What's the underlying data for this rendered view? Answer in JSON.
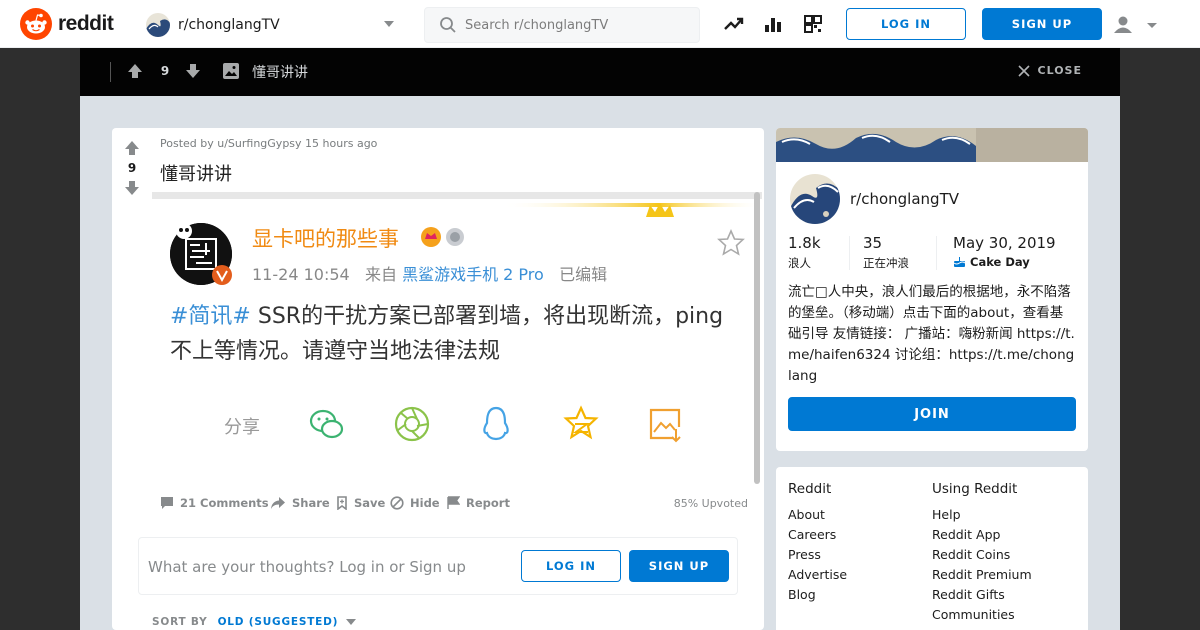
{
  "header": {
    "logo_text": "reddit",
    "community": "r/chonglangTV",
    "search_placeholder": "Search r/chonglangTV",
    "icons": [
      "trending-icon",
      "stats-icon",
      "coins-icon"
    ],
    "login_label": "LOG IN",
    "signup_label": "SIGN UP"
  },
  "overlay": {
    "score": "9",
    "title": "懂哥讲讲",
    "close_label": "CLOSE"
  },
  "post": {
    "score": "9",
    "meta": "Posted by u/SurfingGypsy 15 hours ago",
    "title": "懂哥讲讲",
    "image": {
      "name": "显卡吧的那些事",
      "time": "11-24 10:54",
      "source_prefix": "来自",
      "phone": "黑鲨游戏手机 2 Pro",
      "edited": "已编辑",
      "hashtag": "#简讯#",
      "body": " SSR的干扰方案已部署到墙，将出现断流，ping不上等情况。请遵守当地法律法规",
      "share_label": "分享"
    },
    "actions": {
      "comments": "21 Comments",
      "share": "Share",
      "save": "Save",
      "hide": "Hide",
      "report": "Report",
      "upvoted": "85% Upvoted"
    },
    "comment_placeholder": "What are your thoughts? Log in or Sign up",
    "comment_login": "LOG IN",
    "comment_signup": "SIGN UP",
    "sort_label": "SORT BY",
    "sort_value": "OLD (SUGGESTED)"
  },
  "sidebar": {
    "name": "r/chonglangTV",
    "members": "1.8k",
    "members_label": "浪人",
    "online": "35",
    "online_label": "正在冲浪",
    "created": "May 30, 2019",
    "created_label": "Cake Day",
    "description": "流亡□人中央，浪人们最后的根据地，永不陷落的堡垒。（移动端）点击下面的about，查看基础引导 友情链接： 广播站：嗨粉新闻 https://t.me/haifen6324 讨论组：https://t.me/chonglang",
    "join_label": "JOIN"
  },
  "footer_links": {
    "col1_head": "Reddit",
    "col1": [
      "About",
      "Careers",
      "Press",
      "Advertise",
      "Blog"
    ],
    "col2_head": "Using Reddit",
    "col2": [
      "Help",
      "Reddit App",
      "Reddit Coins",
      "Reddit Premium",
      "Reddit Gifts",
      "Communities"
    ]
  },
  "colors": {
    "brand_orange": "#ff4500",
    "accent_blue": "#0079d3",
    "overlay_black": "#030303",
    "page_bg": "#dae0e6"
  }
}
